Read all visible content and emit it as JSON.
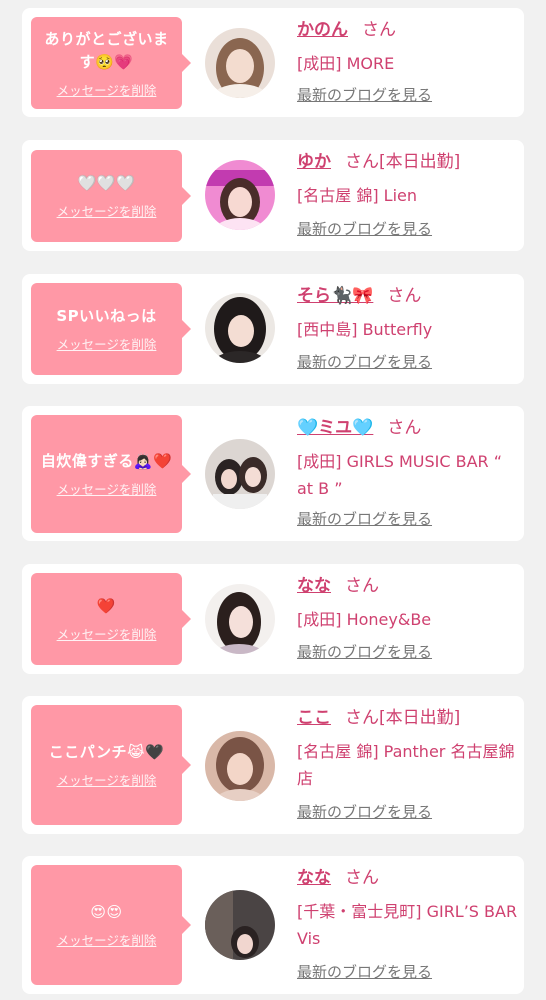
{
  "cards": [
    {
      "message": "ありがとございます🥺💗",
      "delete_label": "メッセージを削除",
      "name": "かのん",
      "suffix": "さん",
      "status": "",
      "shop": "[成田] MORE",
      "blog_label": "最新のブログを見る"
    },
    {
      "message": "🤍🤍🤍",
      "delete_label": "メッセージを削除",
      "name": "ゆか",
      "suffix": "さん",
      "status": "[本日出勤]",
      "shop": "[名古屋 錦] Lien",
      "blog_label": "最新のブログを見る"
    },
    {
      "message": "SPいいねっは",
      "delete_label": "メッセージを削除",
      "name": "そら🐈‍⬛🎀",
      "suffix": "さん",
      "status": "",
      "shop": "[西中島] Butterfly",
      "blog_label": "最新のブログを見る"
    },
    {
      "message": "自炊偉すぎる🙇🏻‍♀️❤️",
      "delete_label": "メッセージを削除",
      "name": "🩵ミユ🩵",
      "suffix": "さん",
      "status": "",
      "shop": "[成田] GIRLS MUSIC BAR “ at B ”",
      "blog_label": "最新のブログを見る"
    },
    {
      "message": "❤️",
      "delete_label": "メッセージを削除",
      "name": "なな",
      "suffix": "さん",
      "status": "",
      "shop": "[成田] Honey&Be",
      "blog_label": "最新のブログを見る"
    },
    {
      "message": "ここパンチ😹🖤",
      "delete_label": "メッセージを削除",
      "name": "ここ",
      "suffix": "さん",
      "status": "[本日出勤]",
      "shop": "[名古屋 錦] Panther 名古屋錦店",
      "blog_label": "最新のブログを見る"
    },
    {
      "message": "😍😍",
      "delete_label": "メッセージを削除",
      "name": "なな",
      "suffix": "さん",
      "status": "",
      "shop": "[千葉・富士見町] GIRL’S BAR Vis",
      "blog_label": "最新のブログを見る"
    }
  ],
  "colors": {
    "page_bg": "#f1f1f1",
    "bubble": "#ff98a6",
    "accent_text": "#cf4170",
    "link_gray": "#777777"
  }
}
